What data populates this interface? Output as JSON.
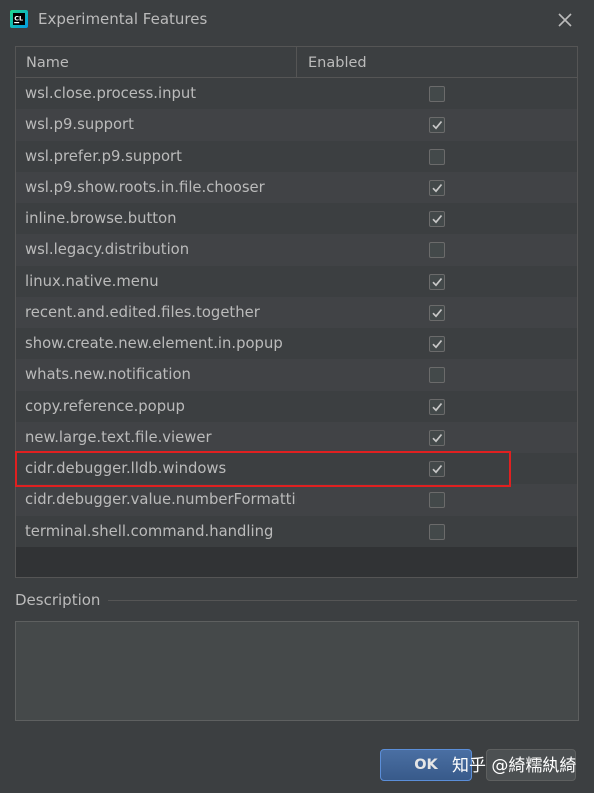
{
  "window": {
    "title": "Experimental Features",
    "app_icon": "clion-icon",
    "close_icon": "close-icon"
  },
  "table": {
    "columns": {
      "name": "Name",
      "enabled": "Enabled"
    },
    "rows": [
      {
        "name": "wsl.close.process.input",
        "checked": false
      },
      {
        "name": "wsl.p9.support",
        "checked": true
      },
      {
        "name": "wsl.prefer.p9.support",
        "checked": false
      },
      {
        "name": "wsl.p9.show.roots.in.file.chooser",
        "checked": true
      },
      {
        "name": "inline.browse.button",
        "checked": true
      },
      {
        "name": "wsl.legacy.distribution",
        "checked": false
      },
      {
        "name": "linux.native.menu",
        "checked": true
      },
      {
        "name": "recent.and.edited.files.together",
        "checked": true
      },
      {
        "name": "show.create.new.element.in.popup",
        "checked": true
      },
      {
        "name": "whats.new.notification",
        "checked": false
      },
      {
        "name": "copy.reference.popup",
        "checked": true
      },
      {
        "name": "new.large.text.file.viewer",
        "checked": true
      },
      {
        "name": "cidr.debugger.lldb.windows",
        "checked": true
      },
      {
        "name": "cidr.debugger.value.numberFormatting",
        "checked": false
      },
      {
        "name": "terminal.shell.command.handling",
        "checked": false
      }
    ]
  },
  "description": {
    "label": "Description",
    "text": ""
  },
  "buttons": {
    "ok": "OK"
  },
  "watermark": "知乎 @綺糯紈綺",
  "colors": {
    "background": "#3c3f41",
    "highlight": "#e02020",
    "ok_button": "#4a6fa3"
  }
}
